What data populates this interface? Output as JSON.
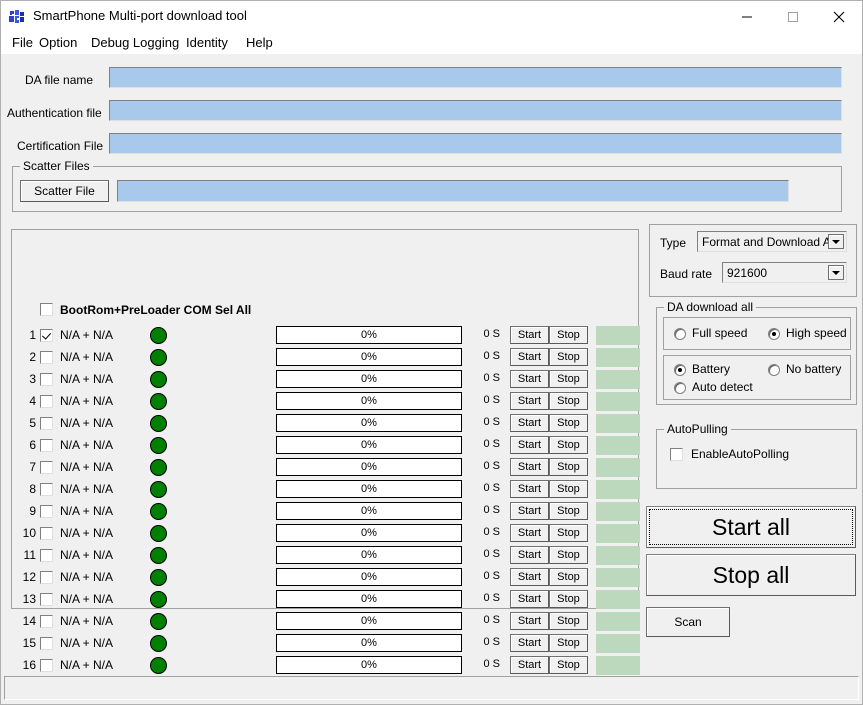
{
  "window": {
    "title": "SmartPhone Multi-port download tool",
    "icon": "app-blocks-icon",
    "controls": {
      "minimize": "–",
      "maximize": "□",
      "close": "✕"
    }
  },
  "menu": {
    "items": [
      "File",
      "Option",
      "Debug Logging",
      "Identity",
      "Help"
    ]
  },
  "files": {
    "da_label": "DA file name",
    "da_value": "",
    "auth_label": "Authentication file",
    "auth_value": "",
    "cert_label": "Certification File",
    "cert_value": "",
    "scatter_group": "Scatter Files",
    "scatter_button": "Scatter File",
    "scatter_value": ""
  },
  "ports": {
    "header_label": "BootRom+PreLoader COM Sel All",
    "header_checked": false,
    "start_label": "Start",
    "stop_label": "Stop",
    "rows": [
      {
        "num": "1",
        "checked": true,
        "name": "N/A + N/A",
        "led": "green",
        "progress": "0%",
        "time": "0 S"
      },
      {
        "num": "2",
        "checked": false,
        "name": "N/A + N/A",
        "led": "green",
        "progress": "0%",
        "time": "0 S"
      },
      {
        "num": "3",
        "checked": false,
        "name": "N/A + N/A",
        "led": "green",
        "progress": "0%",
        "time": "0 S"
      },
      {
        "num": "4",
        "checked": false,
        "name": "N/A + N/A",
        "led": "green",
        "progress": "0%",
        "time": "0 S"
      },
      {
        "num": "5",
        "checked": false,
        "name": "N/A + N/A",
        "led": "green",
        "progress": "0%",
        "time": "0 S"
      },
      {
        "num": "6",
        "checked": false,
        "name": "N/A + N/A",
        "led": "green",
        "progress": "0%",
        "time": "0 S"
      },
      {
        "num": "7",
        "checked": false,
        "name": "N/A + N/A",
        "led": "green",
        "progress": "0%",
        "time": "0 S"
      },
      {
        "num": "8",
        "checked": false,
        "name": "N/A + N/A",
        "led": "green",
        "progress": "0%",
        "time": "0 S"
      },
      {
        "num": "9",
        "checked": false,
        "name": "N/A + N/A",
        "led": "green",
        "progress": "0%",
        "time": "0 S"
      },
      {
        "num": "10",
        "checked": false,
        "name": "N/A + N/A",
        "led": "green",
        "progress": "0%",
        "time": "0 S"
      },
      {
        "num": "11",
        "checked": false,
        "name": "N/A + N/A",
        "led": "green",
        "progress": "0%",
        "time": "0 S"
      },
      {
        "num": "12",
        "checked": false,
        "name": "N/A + N/A",
        "led": "green",
        "progress": "0%",
        "time": "0 S"
      },
      {
        "num": "13",
        "checked": false,
        "name": "N/A + N/A",
        "led": "green",
        "progress": "0%",
        "time": "0 S"
      },
      {
        "num": "14",
        "checked": false,
        "name": "N/A + N/A",
        "led": "green",
        "progress": "0%",
        "time": "0 S"
      },
      {
        "num": "15",
        "checked": false,
        "name": "N/A + N/A",
        "led": "green",
        "progress": "0%",
        "time": "0 S"
      },
      {
        "num": "16",
        "checked": false,
        "name": "N/A + N/A",
        "led": "green",
        "progress": "0%",
        "time": "0 S"
      }
    ]
  },
  "options": {
    "type_label": "Type",
    "type_value": "Format and Download All",
    "baud_label": "Baud rate",
    "baud_value": "921600",
    "da_group": "DA download all",
    "speed": [
      {
        "label": "Full speed",
        "selected": false
      },
      {
        "label": "High speed",
        "selected": true
      }
    ],
    "battery": [
      {
        "label": "Battery",
        "selected": true
      },
      {
        "label": "No battery",
        "selected": false
      },
      {
        "label": "Auto detect",
        "selected": false
      }
    ],
    "autopull_group": "AutoPulling",
    "autopull_label": "EnableAutoPolling",
    "autopull_checked": false
  },
  "actions": {
    "start_all": "Start all",
    "stop_all": "Stop all",
    "scan": "Scan"
  },
  "colors": {
    "led_green": "#008000",
    "status_green": "#bdd9bd",
    "field_blue": "#a8c8ec",
    "face": "#f0f0f0"
  },
  "statusbar": {
    "text": ""
  }
}
